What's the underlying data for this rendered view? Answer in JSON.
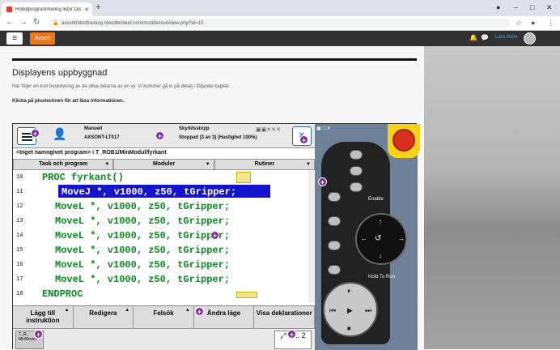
{
  "browser": {
    "tab_title": "Robotprogrammering listor Dis",
    "new_tab": "+",
    "url": "axsontrobottraining.moodlecloud.com/mod/lesson/view.php?id=10"
  },
  "site": {
    "menu_icon": "≡",
    "course_button": "Axson",
    "user_name": "Lara Holm"
  },
  "lesson": {
    "heading": "Displayens uppbyggnad",
    "intro": "Här följer en kort beskrivning av de olika delarna av en vy. Vi kommer gå in på detalj i följande kapitel.",
    "hint": "Klicka på plustecknen för att läsa informationen."
  },
  "pendant": {
    "mode": "Manuell",
    "serial": "AXSONT-LT017",
    "status1": "Skyddsstopp",
    "status2": "Stoppad (3 av 3) (Hastighet 100%)",
    "crumb": "<Inget namngivet program> i T_ROB1/MinModul/fyrkant",
    "columns": [
      "Task och program",
      "Moduler",
      "Rutiner"
    ],
    "lines": [
      {
        "num": "10",
        "code": "PROC fyrkant()"
      },
      {
        "num": "11",
        "code": "MoveJ *, v1000, z50, tGripper;"
      },
      {
        "num": "12",
        "code": "MoveL *, v1000, z50, tGripper;"
      },
      {
        "num": "13",
        "code": "MoveL *, v1000, z50, tGripper;"
      },
      {
        "num": "14",
        "code": "MoveL *, v1000, z50, tGripper;"
      },
      {
        "num": "15",
        "code": "MoveL *, v1000, z50, tGripper;"
      },
      {
        "num": "16",
        "code": "MoveL *, v1000, z50, tGripper;"
      },
      {
        "num": "17",
        "code": "MoveL *, v1000, z50, tGripper;"
      },
      {
        "num": "18",
        "code": "ENDPROC"
      }
    ],
    "bottom": [
      "Lägg till instruktion",
      "Redigera",
      "Felsök",
      "Ändra läge",
      "Visa deklarationer"
    ],
    "task_label": "T_R... MinModul",
    "jog_label": "R... 2",
    "enable_label": "Enable",
    "hold_label": "Hold To Run"
  }
}
